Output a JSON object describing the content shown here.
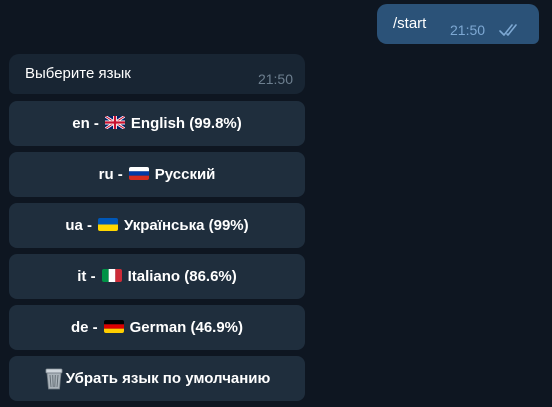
{
  "chat": {
    "outgoing": {
      "text": "/start",
      "time": "21:50",
      "status_icon": "double-check-icon"
    },
    "incoming": {
      "text": "Выберите язык",
      "time": "21:50"
    }
  },
  "keyboard": {
    "buttons": [
      {
        "code": "en -",
        "flag": "uk-flag-icon",
        "label": "English (99.8%)"
      },
      {
        "code": "ru -",
        "flag": "russia-flag-icon",
        "label": "Русский"
      },
      {
        "code": "ua -",
        "flag": "ukraine-flag-icon",
        "label": "Українська (99%)"
      },
      {
        "code": "it -",
        "flag": "italy-flag-icon",
        "label": "Italiano (86.6%)"
      },
      {
        "code": "de -",
        "flag": "germany-flag-icon",
        "label": "German (46.9%)"
      },
      {
        "icon": "trash-can-icon",
        "label": "Убрать язык по умолчанию"
      }
    ]
  },
  "colors": {
    "background": "#0e1621",
    "outgoing_bubble": "#2b5278",
    "incoming_bubble": "#182533",
    "button": "#1f2e3d",
    "timestamp_out": "#7da8d3",
    "timestamp_in": "#6d7f8f"
  }
}
